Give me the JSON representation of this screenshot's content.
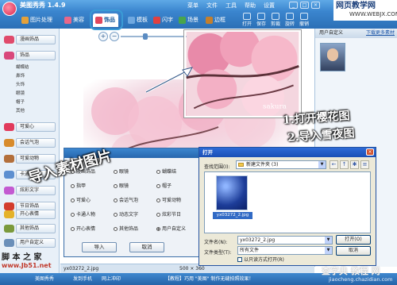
{
  "app": {
    "title": "美图秀秀 1.4.9",
    "icon": "meitu-app-icon"
  },
  "menu": [
    "菜单",
    "文件",
    "工具",
    "帮助",
    "设置"
  ],
  "site_watermark": {
    "title": "网页教学网",
    "url": "WWW.WEBJX.COM"
  },
  "tabs": [
    {
      "label": "图片处理",
      "icon": "image-icon",
      "color": "#e5a13a"
    },
    {
      "label": "美容",
      "icon": "beauty-icon",
      "color": "#e8678a"
    },
    {
      "label": "饰品",
      "icon": "ornament-icon",
      "color": "#e0485d"
    },
    {
      "label": "模板",
      "icon": "template-icon",
      "color": "#6fa8e0"
    },
    {
      "label": "闪字",
      "icon": "flash-text-icon",
      "color": "#e04040"
    },
    {
      "label": "场景",
      "icon": "scene-icon",
      "color": "#49a54b"
    },
    {
      "label": "边框",
      "icon": "frame-icon",
      "color": "#c47f2c"
    }
  ],
  "toolbar": [
    "打开",
    "保存",
    "剪裁",
    "旋转",
    "撤销"
  ],
  "zoom": {
    "in": "+",
    "out": "−"
  },
  "left_panel": {
    "items": [
      {
        "label": "漫画饰品",
        "icon": "comic-icon",
        "color": "#e04a6b"
      },
      {
        "label": "饰品",
        "icon": "bow-icon",
        "color": "#d9487c",
        "children": [
          "蝴蝶结",
          "鼻饰",
          "头饰",
          "眼镜",
          "帽子",
          "其他"
        ]
      },
      {
        "label": "可爱心",
        "icon": "heart-icon",
        "color": "#e13a5c"
      },
      {
        "label": "会话气泡",
        "icon": "bubble-icon",
        "color": "#d88b2c"
      },
      {
        "label": "可爱动物",
        "icon": "animal-icon",
        "color": "#b36f3b"
      },
      {
        "label": "卡通人物",
        "icon": "cartoon-icon",
        "color": "#5d8fd0"
      },
      {
        "label": "炫彩文字",
        "icon": "text-icon",
        "color": "#c35ad1"
      },
      {
        "label": "节日饰品",
        "icon": "gift-icon",
        "color": "#d33c2d"
      },
      {
        "label": "开心表情",
        "icon": "smile-icon",
        "color": "#e4b22a"
      },
      {
        "label": "其他饰品",
        "icon": "misc-icon",
        "color": "#7b9a3c"
      },
      {
        "label": "用户自定义",
        "icon": "user-icon",
        "color": "#6a8fb9"
      }
    ]
  },
  "annotations": {
    "step1": "1.打开樱花图",
    "step2": "2.导入雪夜图",
    "import": "导入素材图片"
  },
  "canvas_text": "sakura",
  "right_panel": {
    "title": "用户自定义",
    "link": "下载更多素材"
  },
  "import_dialog": {
    "options": [
      [
        "漫画饰品",
        "眼镜",
        "蝴蝶结"
      ],
      [
        "指甲",
        "眼镜",
        "帽子"
      ],
      [
        "可爱心",
        "会话气泡",
        "可爱动物"
      ],
      [
        "卡通人物",
        "动态文字",
        "炫彩节日"
      ],
      [
        "开心表情",
        "其他饰品",
        "用户自定义"
      ]
    ],
    "selected": "用户自定义",
    "import_button": "导入",
    "cancel_button": "取消"
  },
  "open_dialog": {
    "title": "打开",
    "look_in_label": "查找范围(I):",
    "look_in_value": "新建文件夹 (3)",
    "file_item": "yx03272_2.jpg",
    "filename_label": "文件名(N):",
    "filename_value": "yx03272_2.jpg",
    "filetype_label": "文件类型(T):",
    "filetype_value": "所有文件",
    "open_button": "打开(O)",
    "cancel_button": "取消",
    "readonly_label": "以只读方式打开(R)"
  },
  "info_bar": {
    "file": "yx03272_2.jpg",
    "size": "500 × 360"
  },
  "status_bar": {
    "left": "美图秀秀",
    "phone": "发到手机",
    "online": "网上冲印",
    "tip": "【教程】巧用 \"美图\" 制作无缝拍照效果！"
  },
  "watermarks": {
    "left_line1": "脚 本 之 家",
    "left_url": "www.Jb51.net",
    "right_line1": "查字典 教程 网",
    "right_line2": "jiaocheng.chazidian.com"
  }
}
